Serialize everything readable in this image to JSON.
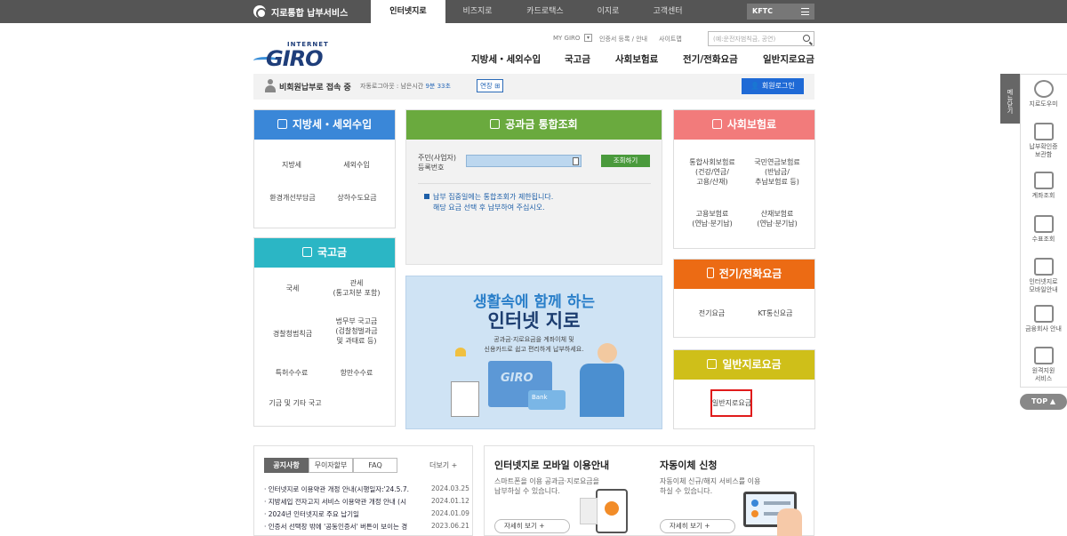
{
  "topbar": {
    "brand": "지로통합 납부서비스",
    "tabs": [
      "인터넷지로",
      "비즈지로",
      "카드로택스",
      "이지로",
      "고객센터"
    ],
    "active_tab": "인터넷지로",
    "kftc": "KFTC"
  },
  "header": {
    "logo_small": "INTERNET",
    "logo_big": "GIRO",
    "util_links": [
      "MY GIRO",
      "인증서 등록 / 안내",
      "사이트맵"
    ],
    "search_placeholder": "(예:운전자범칙금, 공연)",
    "nav": [
      "지방세・세외수입",
      "국고금",
      "사회보험료",
      "전기/전화요금",
      "일반지로요금"
    ]
  },
  "status": {
    "user": "비회원납부로 접속 중",
    "auto_logout": "자동로그아웃 : 남은시간",
    "remaining": "9분 33초",
    "extend": "연장",
    "login": "회원로그인"
  },
  "local_tax": {
    "title": "지방세・세외수입",
    "items": [
      "지방세",
      "세외수입",
      "환경개선부담금",
      "상하수도요금"
    ]
  },
  "national": {
    "title": "국고금",
    "items": [
      "국세",
      "관세\n(통고처분 포함)",
      "경찰청범칙금",
      "법무부 국고금\n(검찰청벌과금\n및 과태료 등)",
      "특허수수료",
      "항만수수료",
      "기금 및 기타 국고"
    ]
  },
  "integrated": {
    "title": "공과금 통합조회",
    "id_label": "주민(사업자)\n등록번호",
    "lookup": "조회하기",
    "notice1": "납부 집중일에는 통합조회가 제한됩니다.",
    "notice2": "해당 요금 선택 후 납부하여 주십시오."
  },
  "banner": {
    "line1": "생활속에 함께 하는",
    "line2": "인터넷 지로",
    "desc1": "공과금·지로요금을 계좌이체 및",
    "desc2": "신용카드로 쉽고 편리하게 납부하세요.",
    "card_text": "GIRO",
    "bank_text": "Bank"
  },
  "social": {
    "title": "사회보험료",
    "items": [
      "통합사회보험료\n(건강/연금/\n고용/산재)",
      "국민연금보험료\n(반납금/\n추납보험료 등)",
      "고용보험료\n(연납·분기납)",
      "산재보험료\n(연납·분기납)"
    ]
  },
  "telecom": {
    "title": "전기/전화요금",
    "items": [
      "전기요금",
      "KT통신요금"
    ]
  },
  "general": {
    "title": "일반지로요금",
    "item": "일반지로요금"
  },
  "board": {
    "tabs": [
      "공지사항",
      "무이자할부",
      "FAQ"
    ],
    "more": "더보기 +",
    "news": [
      {
        "title": "인터넷지로 이용약관 개정 안내(시행일자:'24.5.7.",
        "date": "2024.03.25"
      },
      {
        "title": "지방세입 전자고지 서비스 이용약관 개정 안내 (시",
        "date": "2024.01.12"
      },
      {
        "title": "2024년 인터넷지로 주요 납기일",
        "date": "2024.01.09"
      },
      {
        "title": "인증서 선택창 밖에 '공동인증서' 버튼이 보이는 경",
        "date": "2023.06.21"
      }
    ]
  },
  "mobile_promo": {
    "title": "인터넷지로 모바일 이용안내",
    "desc1": "스마트폰을 이용 공과금·지로요금을",
    "desc2": "납부하실 수 있습니다.",
    "btn": "자세히 보기  +"
  },
  "auto_promo": {
    "title": "자동이체 신청",
    "desc1": "자동이체 신규/해지 서비스를 이용",
    "desc2": "하실 수 있습니다.",
    "btn": "자세히 보기  +"
  },
  "sidebar": {
    "menu_tab": "메뉴닫기",
    "items": [
      "지로도우미",
      "납부확인증\n보관함",
      "계좌조회",
      "수표조회",
      "인터넷지로\n모바일안내",
      "금융회사 안내",
      "원격지원\n서비스"
    ],
    "top": "TOP"
  },
  "colors": {
    "local_tax": "#3a87d8",
    "national": "#2bb6c5",
    "integrated": "#6aaa3e",
    "social": "#f27b7b",
    "telecom": "#ec6b14",
    "general": "#cfbf19"
  }
}
